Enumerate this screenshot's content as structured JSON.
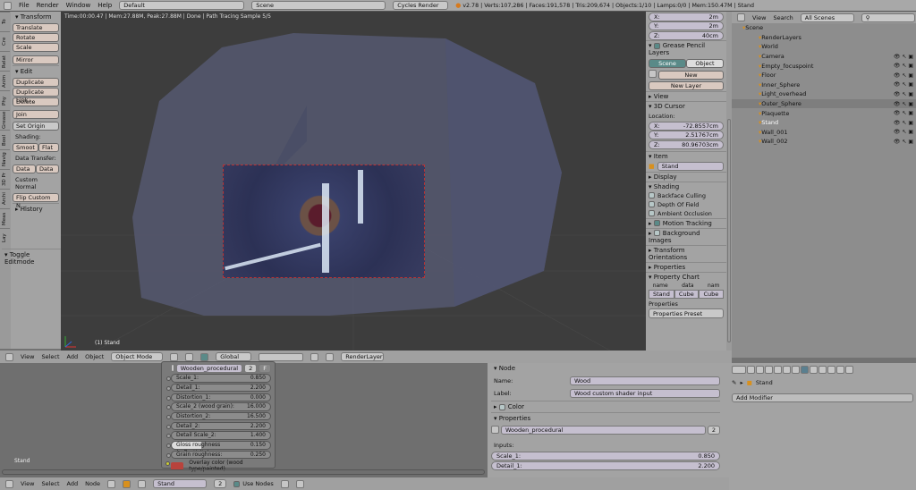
{
  "topbar": {
    "menus": [
      "File",
      "Render",
      "Window",
      "Help"
    ],
    "layout": "Default",
    "scene": "Scene",
    "engine": "Cycles Render",
    "stats": "v2.78 | Verts:107,286 | Faces:191,578 | Tris:209,674 | Objects:1/10 | Lamps:0/0 | Mem:150.47M | Stand"
  },
  "viewport": {
    "status": "Time:00:00.47 | Mem:27.88M, Peak:27.88M | Done | Path Tracing Sample 5/5",
    "object_label": "(1) Stand"
  },
  "tool_tabs": [
    "To",
    "Cre",
    "Relat",
    "Anim",
    "Phy",
    "Grease",
    "Bool",
    "Navig",
    "3D Pr",
    "Archi",
    "Meas",
    "Lay"
  ],
  "toolshelf": {
    "transform": "Transform",
    "translate": "Translate",
    "rotate": "Rotate",
    "scale": "Scale",
    "mirror": "Mirror",
    "edit": "Edit",
    "duplicate": "Duplicate",
    "duplicate_linked": "Duplicate Link...",
    "delete": "Delete",
    "join": "Join",
    "set_origin": "Set Origin",
    "shading": "Shading:",
    "smooth": "Smoot",
    "flat": "Flat",
    "data_transfer": "Data Transfer:",
    "data": "Data",
    "data_la": "Data La",
    "custom_normal": "Custom Normal",
    "flip": "Flip Custom N...",
    "history": "History",
    "toggle_editmode": "Toggle Editmode"
  },
  "npanel": {
    "dims": [
      {
        "k": "X:",
        "v": "2m"
      },
      {
        "k": "Y:",
        "v": "2m"
      },
      {
        "k": "Z:",
        "v": "40cm"
      }
    ],
    "grease": "Grease Pencil Layers",
    "scene_tab": "Scene",
    "object_tab": "Object",
    "new": "New",
    "new_layer": "New Layer",
    "view": "View",
    "cursor": "3D Cursor",
    "location": "Location:",
    "loc": [
      {
        "k": "X:",
        "v": "-72.8557cm"
      },
      {
        "k": "Y:",
        "v": "2.51767cm"
      },
      {
        "k": "Z:",
        "v": "80.96703cm"
      }
    ],
    "item": "Item",
    "item_name": "Stand",
    "display": "Display",
    "shading": "Shading",
    "backface": "Backface Culling",
    "dof": "Depth Of Field",
    "ao": "Ambient Occlusion",
    "motion": "Motion Tracking",
    "bg": "Background Images",
    "orient": "Transform Orientations",
    "properties": "Properties",
    "chart": "Property Chart",
    "chart_h": [
      "name",
      "data",
      "nam"
    ],
    "chart_v": [
      "Stand",
      "Cube",
      "Cube"
    ],
    "props_label": "Properties",
    "preset": "Properties Preset"
  },
  "outliner": {
    "view": "View",
    "search": "Search",
    "filter": "All Scenes",
    "items": [
      {
        "name": "Scene",
        "lvl": 0,
        "vis": false
      },
      {
        "name": "RenderLayers",
        "lvl": 1,
        "vis": false
      },
      {
        "name": "World",
        "lvl": 1,
        "vis": false
      },
      {
        "name": "Camera",
        "lvl": 1,
        "vis": true
      },
      {
        "name": "Empty_focuspoint",
        "lvl": 1,
        "vis": true
      },
      {
        "name": "Floor",
        "lvl": 1,
        "vis": true
      },
      {
        "name": "Inner_Sphere",
        "lvl": 1,
        "vis": true
      },
      {
        "name": "Light_overhead",
        "lvl": 1,
        "vis": true
      },
      {
        "name": "Outer_Sphere",
        "lvl": 1,
        "vis": true,
        "sel": true
      },
      {
        "name": "Plaquette",
        "lvl": 1,
        "vis": true
      },
      {
        "name": "Stand",
        "lvl": 1,
        "vis": true,
        "active": true
      },
      {
        "name": "Wall_001",
        "lvl": 1,
        "vis": true
      },
      {
        "name": "Wall_002",
        "lvl": 1,
        "vis": true
      }
    ]
  },
  "view3d_header": {
    "menus": [
      "View",
      "Select",
      "Add",
      "Object"
    ],
    "mode": "Object Mode",
    "orientation": "Global",
    "renderlayer": "RenderLayer"
  },
  "node": {
    "group": "Wooden_procedural",
    "users": "2",
    "fake": "F",
    "inputs": [
      {
        "k": "Scale_1:",
        "v": "0.850"
      },
      {
        "k": "Detail_1:",
        "v": "2.200"
      },
      {
        "k": "Distortion_1:",
        "v": "0.000"
      },
      {
        "k": "Scale_2 (wood grain):",
        "v": "16.000"
      },
      {
        "k": "Distortion_2:",
        "v": "16.500"
      },
      {
        "k": "Detail_2:",
        "v": "2.200"
      },
      {
        "k": "Detail Scale_2:",
        "v": "1.400"
      },
      {
        "k": "Gloss roughness (reflectivity):",
        "v": "0.150"
      },
      {
        "k": "Grain roughness:",
        "v": "0.250"
      }
    ],
    "overlay": "Overlay color (wood type/painted)",
    "overlay_color": "#b8433c",
    "corner_label": "Stand"
  },
  "node_props": {
    "node": "Node",
    "name_label": "Name:",
    "name": "Wood",
    "label_label": "Label:",
    "label": "Wood custom shader input",
    "color": "Color",
    "properties": "Properties",
    "group": "Wooden_procedural",
    "users": "2",
    "inputs": "Inputs:",
    "first": {
      "k": "Scale_1:",
      "v": "0.850"
    },
    "second": {
      "k": "Detail_1:",
      "v": "2.200"
    }
  },
  "properties_editor": {
    "object": "Stand",
    "add_modifier": "Add Modifier"
  },
  "node_header": {
    "menus": [
      "View",
      "Select",
      "Add",
      "Node"
    ],
    "material": "Stand",
    "users": "2",
    "use_nodes": "Use Nodes"
  },
  "colors": {
    "accent": "#5a8a88",
    "selected": "#7e7e7e",
    "active_text": "#ffffff"
  }
}
